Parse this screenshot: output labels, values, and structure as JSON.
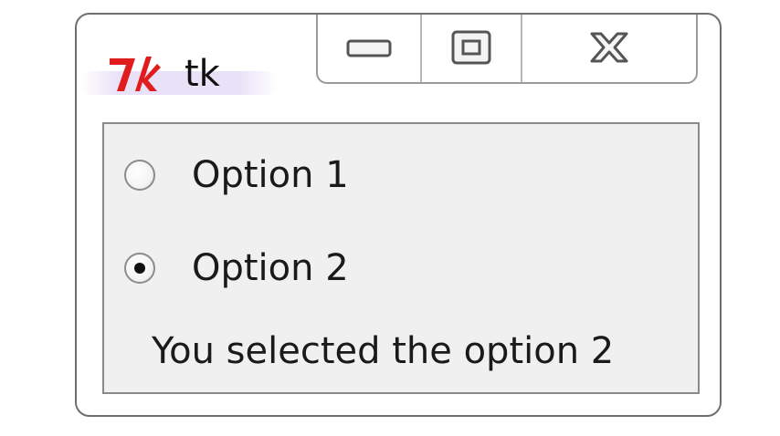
{
  "window": {
    "title": "tk"
  },
  "caption_buttons": {
    "minimize_icon": "minimize-icon",
    "maximize_icon": "maximize-icon",
    "close_icon": "close-icon"
  },
  "radios": [
    {
      "label": "Option 1",
      "selected": false
    },
    {
      "label": "Option 2",
      "selected": true
    }
  ],
  "status": {
    "text": "You selected the option 2"
  },
  "colors": {
    "tk_logo": "#e11c1c",
    "client_bg": "#f0f0f0"
  }
}
